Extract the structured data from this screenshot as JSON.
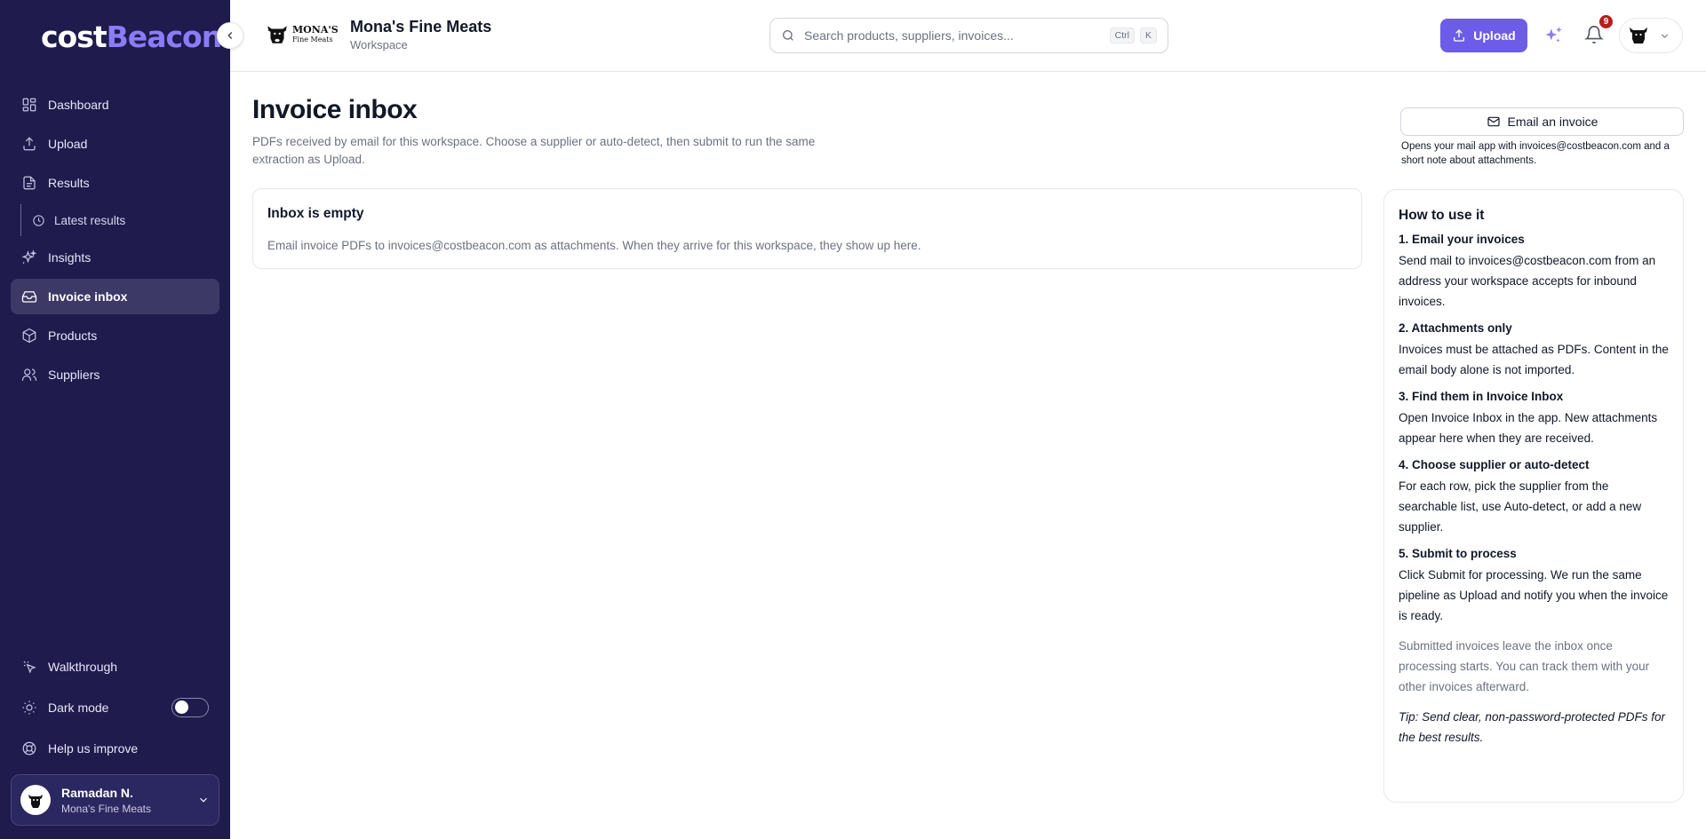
{
  "brand": {
    "part1": "cost",
    "part2": "Beacon"
  },
  "sidebar": {
    "items": [
      {
        "label": "Dashboard",
        "icon": "grid-icon"
      },
      {
        "label": "Upload",
        "icon": "upload-icon"
      },
      {
        "label": "Results",
        "icon": "document-icon"
      },
      {
        "label": "Latest results",
        "icon": "clock-icon"
      },
      {
        "label": "Insights",
        "icon": "sparkles-icon"
      },
      {
        "label": "Invoice inbox",
        "icon": "inbox-icon"
      },
      {
        "label": "Products",
        "icon": "box-icon"
      },
      {
        "label": "Suppliers",
        "icon": "users-icon"
      }
    ],
    "active": "Invoice inbox",
    "bottom": [
      {
        "label": "Walkthrough",
        "icon": "pointer-icon"
      },
      {
        "label": "Dark mode",
        "icon": "sun-icon",
        "toggle": "off"
      },
      {
        "label": "Help us improve",
        "icon": "help-icon"
      }
    ],
    "user": {
      "name": "Ramadan N.",
      "workspace": "Mona's Fine Meats"
    }
  },
  "header": {
    "logo_line1": "MONA'S",
    "logo_line2": "Fine Meats",
    "workspace_name": "Mona's Fine Meats",
    "workspace_label": "Workspace",
    "search_placeholder": "Search products, suppliers, invoices...",
    "kbd_ctrl": "Ctrl",
    "kbd_k": "K",
    "upload_label": "Upload",
    "notifications_count": "9",
    "accent_color": "#6c5ce7"
  },
  "main": {
    "title": "Invoice inbox",
    "description": "PDFs received by email for this workspace. Choose a supplier or auto-detect, then submit to run the same extraction as Upload.",
    "email_button": "Email an invoice",
    "email_note": "Opens your mail app with invoices@costbeacon.com and a short note about attachments.",
    "empty_title": "Inbox is empty",
    "empty_text": "Email invoice PDFs to invoices@costbeacon.com as attachments. When they arrive for this workspace, they show up here."
  },
  "help": {
    "title": "How to use it",
    "steps": [
      {
        "title": "1. Email your invoices",
        "text": "Send mail to invoices@costbeacon.com from an address your workspace accepts for inbound invoices."
      },
      {
        "title": "2. Attachments only",
        "text": "Invoices must be attached as PDFs. Content in the email body alone is not imported."
      },
      {
        "title": "3. Find them in Invoice Inbox",
        "text": "Open Invoice Inbox in the app. New attachments appear here when they are received."
      },
      {
        "title": "4. Choose supplier or auto-detect",
        "text": "For each row, pick the supplier from the searchable list, use Auto-detect, or add a new supplier."
      },
      {
        "title": "5. Submit to process",
        "text": "Click Submit for processing. We run the same pipeline as Upload and notify you when the invoice is ready."
      }
    ],
    "note": "Submitted invoices leave the inbox once processing starts. You can track them with your other invoices afterward.",
    "tip": "Tip: Send clear, non-password-protected PDFs for the best results."
  }
}
